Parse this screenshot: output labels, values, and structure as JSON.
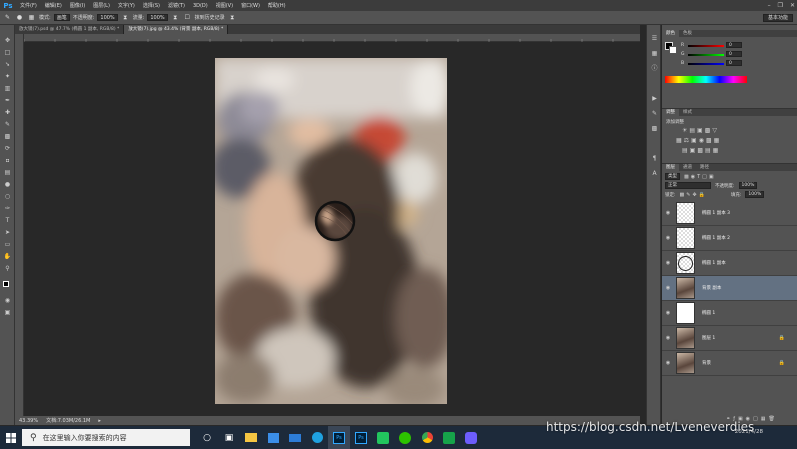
{
  "menubar": {
    "logo": "Ps",
    "items": [
      "文件(F)",
      "编辑(E)",
      "图像(I)",
      "图层(L)",
      "文字(Y)",
      "选择(S)",
      "滤镜(T)",
      "3D(D)",
      "视图(V)",
      "窗口(W)",
      "帮助(H)"
    ]
  },
  "options": {
    "mode_label": "模式:",
    "mode_value": "画笔",
    "opacity_label": "不透明度:",
    "opacity_value": "100%",
    "flow_label": "流量:",
    "flow_value": "100%",
    "history_label": "抹到历史记录",
    "workspace": "基本功能"
  },
  "tabs": [
    {
      "label": "放大镜(7).psd @ 47.7% (椭圆 1 副本, RGB/8) *"
    },
    {
      "label": "放大镜(7).jpg @ 43.4% (背景 副本, RGB/8) *"
    }
  ],
  "status": {
    "zoom": "43.39%",
    "doc": "文档:7.03M/26.1M"
  },
  "panels": {
    "color_tabs": [
      "颜色",
      "色板"
    ],
    "color_channels": [
      {
        "label": "R",
        "value": "0"
      },
      {
        "label": "G",
        "value": "0"
      },
      {
        "label": "B",
        "value": "0"
      }
    ],
    "adjust_tabs": [
      "调整",
      "样式"
    ],
    "adjust_title": "添加调整",
    "layers_tabs": [
      "图层",
      "通道",
      "路径"
    ],
    "kind_label": "类型",
    "blend_mode": "正常",
    "opacity_label": "不透明度:",
    "opacity_value": "100%",
    "lock_label": "锁定:",
    "fill_label": "填充:",
    "fill_value": "100%",
    "layers": [
      {
        "name": "椭圆 1 副本 3",
        "thumb": "transparent"
      },
      {
        "name": "椭圆 1 副本 2",
        "thumb": "transparent"
      },
      {
        "name": "椭圆 1 副本",
        "thumb": "circle"
      },
      {
        "name": "背景 副本",
        "thumb": "photo",
        "selected": true
      },
      {
        "name": "椭圆 1",
        "thumb": "white"
      },
      {
        "name": "图层 1",
        "thumb": "photo",
        "locked": true
      },
      {
        "name": "背景",
        "thumb": "photo",
        "locked": true
      }
    ]
  },
  "taskbar": {
    "search_placeholder": "在这里输入你要搜索的内容",
    "date": "2021/4/28",
    "watermark": "https://blog.csdn.net/Lveneverdies"
  },
  "colors": {
    "ps_blue": "#31a8ff",
    "panel_bg": "#535353",
    "selected_layer": "#637182",
    "taskbar": "#1d2a3a"
  }
}
